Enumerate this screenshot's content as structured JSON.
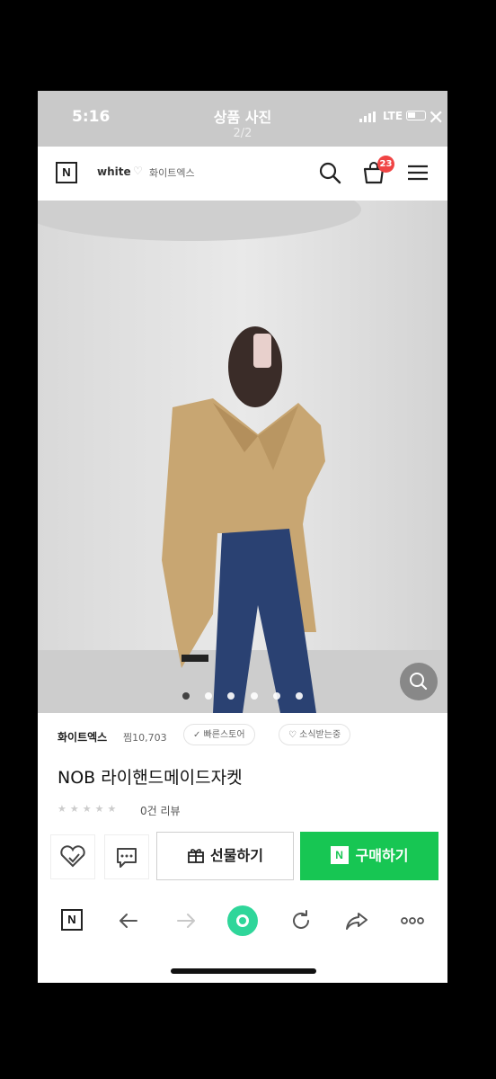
{
  "status_bar": {
    "time": "5:16",
    "title": "상품 사진",
    "page_indicator": "2/2",
    "network": "LTE"
  },
  "header": {
    "logo": "N",
    "store_name_en": "white",
    "store_name_kr": "화이트엑스",
    "cart_count": "23",
    "icons": [
      "search-icon",
      "cart-icon",
      "menu-icon"
    ]
  },
  "hero": {
    "slide_count": 6,
    "active_slide": 1,
    "icons": [
      "zoom-icon"
    ]
  },
  "product": {
    "seller": "화이트엑스",
    "followers": "찜10,703",
    "badge_1": "✓ 빠른스토어",
    "badge_2": "♡ 소식받는중",
    "name": "NOB 라이핸드메이드자켓",
    "rating_stars": "★★★★★",
    "review_count": "0건 리뷰"
  },
  "actions": {
    "gift_label": "선물하기",
    "buy_label": "구매하기",
    "buy_logo": "N",
    "icons": [
      "heart-icon",
      "chat-icon",
      "gift-icon"
    ]
  },
  "browser_bar": {
    "logo": "N",
    "icons": [
      "naver-icon",
      "back-icon",
      "forward-icon",
      "home-icon",
      "refresh-icon",
      "share-icon",
      "more-icon"
    ]
  },
  "colors": {
    "buy_green": "#17c653",
    "badge_red": "#f04444",
    "coat": "#c9a876",
    "jeans": "#2a4172"
  }
}
